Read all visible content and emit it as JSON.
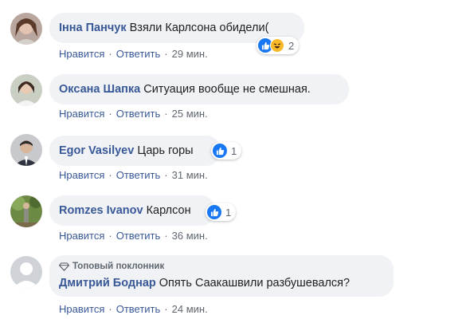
{
  "comments": [
    {
      "author": "Інна Панчук",
      "text": "Взяли Карлсона обидели(",
      "like": "Нравится",
      "reply": "Ответить",
      "time": "29 мин.",
      "reaction_count": "2"
    },
    {
      "author": "Оксана Шапка",
      "text": "Ситуация вообще не смешная.",
      "like": "Нравится",
      "reply": "Ответить",
      "time": "25 мин."
    },
    {
      "author": "Egor Vasilyev",
      "text": "Царь горы",
      "like": "Нравится",
      "reply": "Ответить",
      "time": "31 мин.",
      "reaction_count": "1"
    },
    {
      "author": "Romzes Ivanov",
      "text": "Карлсон",
      "like": "Нравится",
      "reply": "Ответить",
      "time": "36 мин.",
      "reaction_count": "1"
    },
    {
      "badge": "Топовый поклонник",
      "author": "Дмитрий Боднар",
      "text": "Опять Саакашвили разбушевался?",
      "like": "Нравится",
      "reply": "Ответить",
      "time": "24 мин."
    }
  ],
  "colors": {
    "author": "#385898",
    "bubble": "#f0f2f5",
    "meta": "#606770",
    "like_blue": "#1877f2"
  }
}
